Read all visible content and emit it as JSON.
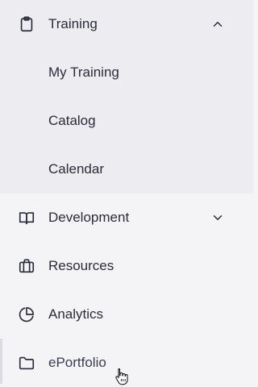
{
  "nav": {
    "training": {
      "label": "Training",
      "icon": "clipboard-icon",
      "expanded": true,
      "children": [
        {
          "label": "My Training"
        },
        {
          "label": "Catalog"
        },
        {
          "label": "Calendar"
        }
      ]
    },
    "development": {
      "label": "Development",
      "icon": "book-open-icon",
      "expanded": false
    },
    "resources": {
      "label": "Resources",
      "icon": "briefcase-icon"
    },
    "analytics": {
      "label": "Analytics",
      "icon": "pie-chart-icon"
    },
    "eportfolio": {
      "label": "ePortfolio",
      "icon": "folder-icon"
    }
  },
  "colors": {
    "expanded_group_bg": "#edecf1",
    "sidebar_bg": "#f4f4f7",
    "text": "#2a2c3a"
  }
}
